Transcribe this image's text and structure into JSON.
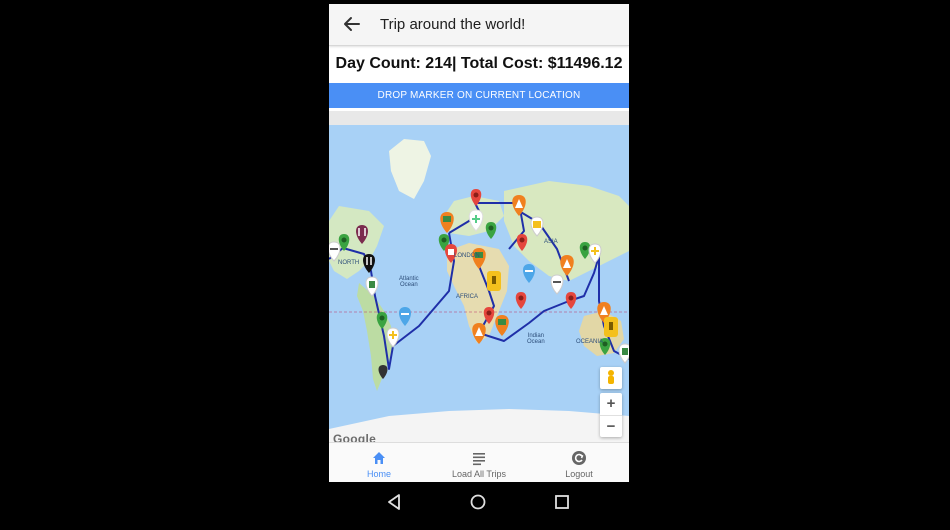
{
  "app_bar": {
    "title": "Trip around the world!",
    "back_icon": "arrow-left-icon"
  },
  "stats": {
    "text": "Day Count: 214| Total Cost: $11496.12"
  },
  "actions": {
    "drop_marker_label": "DROP MARKER ON CURRENT LOCATION"
  },
  "map": {
    "labels": {
      "north": "NORTH",
      "atlantic": "Atlantic\nOcean",
      "africa": "AFRICA",
      "asia": "ASIA",
      "london": "LONDON",
      "indian": "Indian\nOcean",
      "oceania": "OCEANIA"
    },
    "attribution": "Google",
    "zoom_in": "+",
    "zoom_out": "−",
    "route_color": "#1f2fa8",
    "marker_colors": {
      "red": "#e5463d",
      "green": "#3aa341",
      "orange": "#f0801f",
      "yellow": "#f4c01d",
      "blue": "#4da6e8",
      "purple": "#7b2c4e",
      "black": "#111111"
    }
  },
  "bottom_nav": {
    "items": [
      {
        "label": "Home",
        "icon": "home-icon",
        "active": true
      },
      {
        "label": "Load All Trips",
        "icon": "list-icon",
        "active": false
      },
      {
        "label": "Logout",
        "icon": "logout-icon",
        "active": false
      }
    ]
  },
  "system_nav": {
    "back": "back-triangle-icon",
    "home": "home-circle-icon",
    "recents": "recents-square-icon"
  }
}
